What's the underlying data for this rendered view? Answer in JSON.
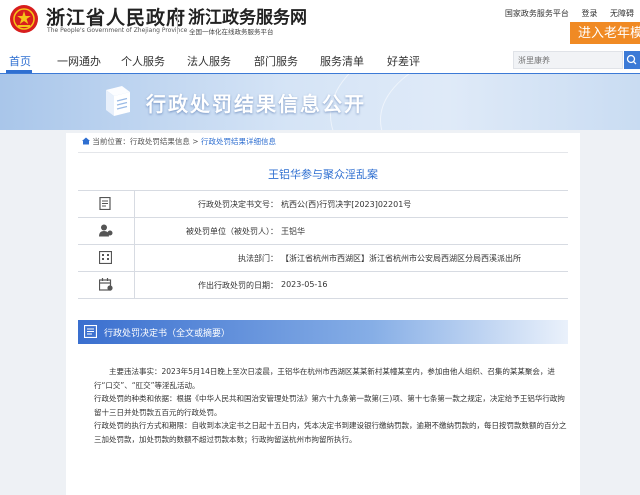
{
  "header": {
    "gov_name": "浙江省人民政府",
    "gov_en": "The People's Government of Zhejiang Province",
    "service_name": "浙江政务服务网",
    "service_slogan": "全国一体化在线政务服务平台",
    "links": [
      "国家政务服务平台",
      "登录",
      "无障碍"
    ],
    "elder_button": "进入老年模式",
    "colors": {
      "accent": "#2f6fd1",
      "elder": "#f08a24",
      "emblem": "#d81e1e"
    }
  },
  "nav": {
    "items": [
      "首页",
      "一网通办",
      "个人服务",
      "法人服务",
      "部门服务",
      "服务清单",
      "好差评"
    ],
    "active_index": 0,
    "search_placeholder": "浙里康养"
  },
  "banner": {
    "title": "行政处罚结果信息公开",
    "icon": "book-icon"
  },
  "breadcrumb": {
    "prefix": "当前位置：",
    "items": [
      "行政处罚结果信息",
      "行政处罚结果详细信息"
    ],
    "separator": " > "
  },
  "case": {
    "title": "王铝华参与聚众淫乱案",
    "fields": [
      {
        "icon": "document-icon",
        "label": "行政处罚决定书文号：",
        "value": "杭西公(西)行罚决字[2023]02201号"
      },
      {
        "icon": "person-icon",
        "label": "被处罚单位（被处罚人）：",
        "value": "王铝华"
      },
      {
        "icon": "building-icon",
        "label": "执法部门：",
        "value": "【浙江省杭州市西湖区】浙江省杭州市公安局西湖区分局西溪派出所"
      },
      {
        "icon": "calendar-icon",
        "label": "作出行政处罚的日期：",
        "value": "2023-05-16"
      }
    ]
  },
  "section": {
    "title": "行政处罚决定书（全文或摘要）",
    "paragraphs": [
      "主要违法事实：2023年5月14日晚上至次日凌晨，王铝华在杭州市西湖区某某新村某幢某室内，参加由他人组织、召集的某某聚会，进行“口交”、“肛交”等淫乱活动。",
      "行政处罚的种类和依据：根据《中华人民共和国治安管理处罚法》第六十九条第一款第(三)项、第十七条第一款之规定，决定给予王铝华行政拘留十三日并处罚款五百元的行政处罚。",
      "行政处罚的执行方式和期限：自收到本决定书之日起十五日内，凭本决定书到建设银行缴纳罚款，逾期不缴纳罚款的，每日按罚款数额的百分之三加处罚款，加处罚款的数额不超过罚款本数；行政拘留送杭州市拘留所执行。"
    ]
  }
}
